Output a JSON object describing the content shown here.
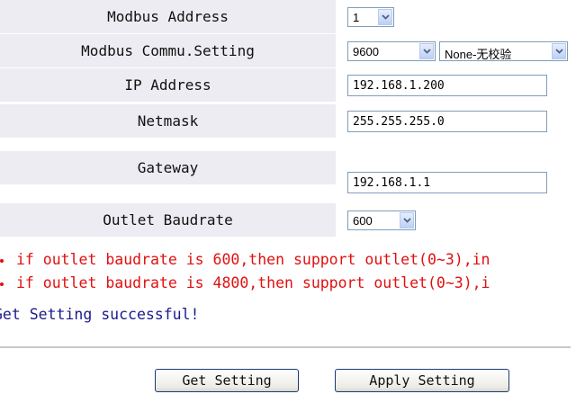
{
  "settings": {
    "modbus_address": {
      "label": "Modbus Address",
      "value": "1"
    },
    "modbus_commu": {
      "label": "Modbus Commu.Setting",
      "baud_value": "9600",
      "parity_value": "None-无校验"
    },
    "ip_address": {
      "label": "IP Address",
      "value": "192.168.1.200"
    },
    "netmask": {
      "label": "Netmask",
      "value": "255.255.255.0"
    },
    "gateway": {
      "label": "Gateway",
      "value": "192.168.1.1"
    },
    "outlet_baudrate": {
      "label": "Outlet Baudrate",
      "value": "600"
    }
  },
  "notes": [
    "if outlet baudrate is 600,then support outlet(0~3),in",
    "if outlet baudrate is 4800,then support outlet(0~3),i"
  ],
  "status": "Get Setting successful!",
  "buttons": {
    "get_label": "Get Setting",
    "apply_label": "Apply Setting"
  },
  "colors": {
    "label_bg": "#ececf2",
    "warning_text": "#e01010",
    "status_text": "#1a1a8c",
    "input_border": "#7f9db9"
  },
  "icons": {
    "dropdown": "chevron-down-icon",
    "bullet": "bullet-icon"
  }
}
